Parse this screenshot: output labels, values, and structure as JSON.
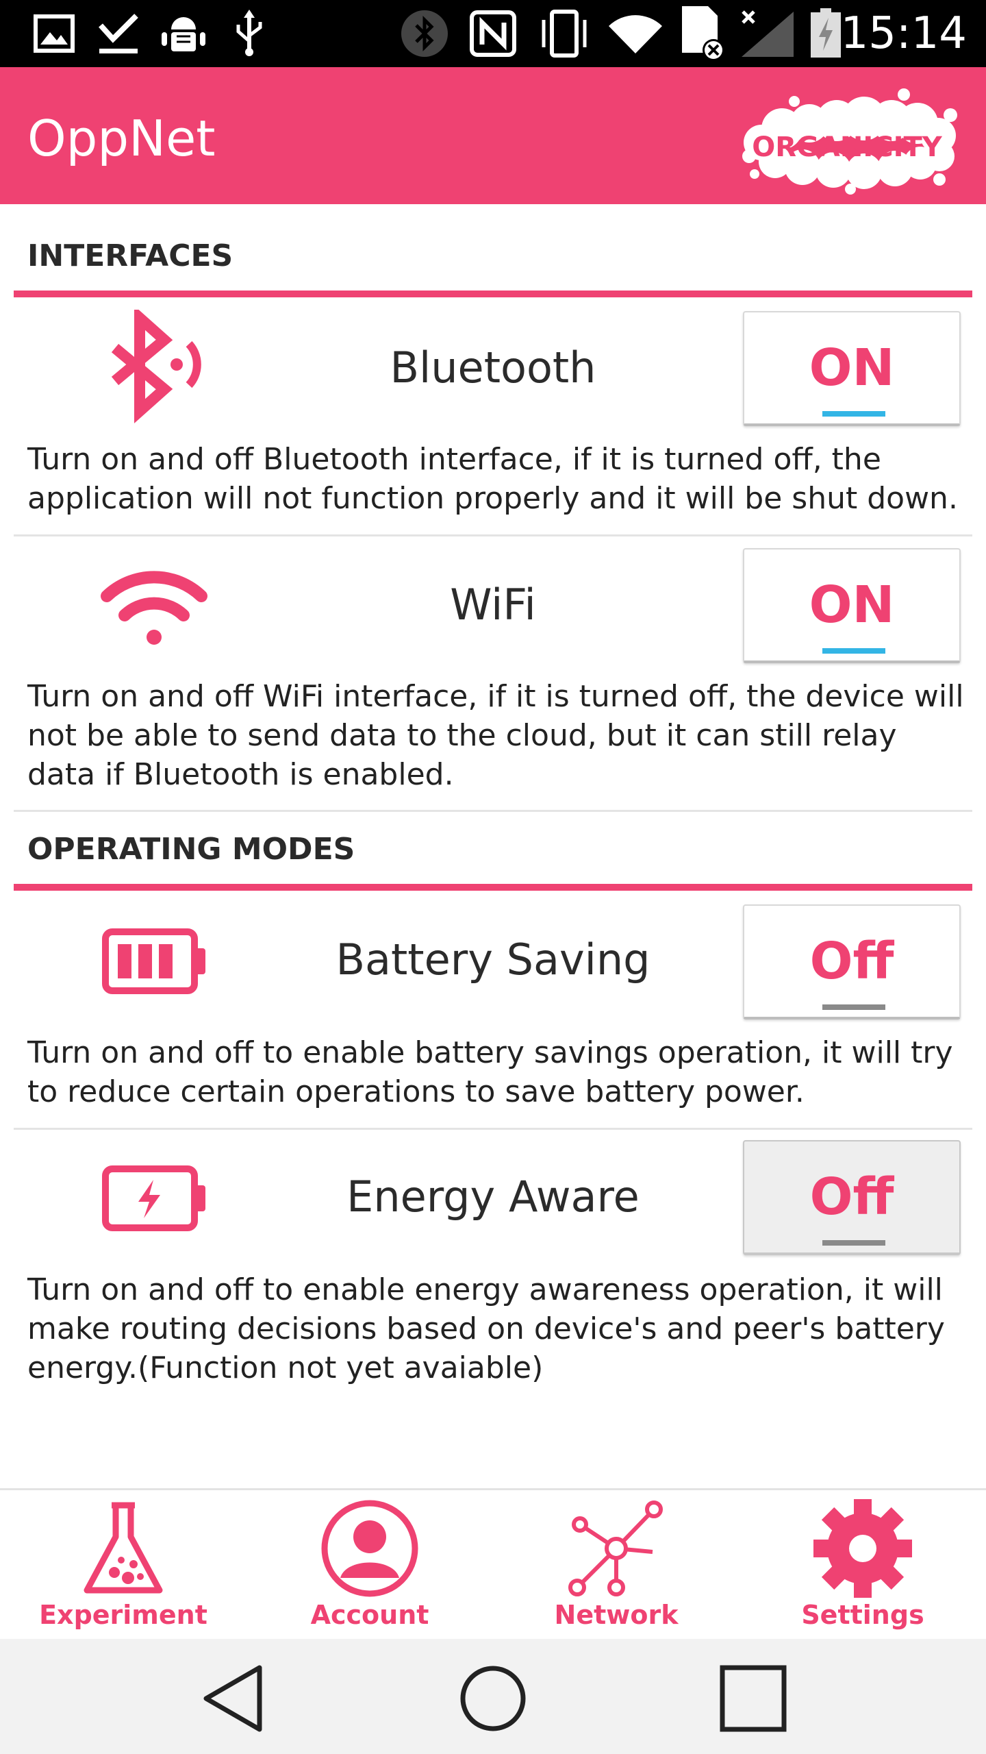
{
  "status_bar": {
    "time": "15:14",
    "icons": [
      "image-icon",
      "download-done-icon",
      "android-debug-icon",
      "usb-icon",
      "bluetooth-icon",
      "nfc-icon",
      "vibrate-icon",
      "wifi-icon",
      "sim-error-icon",
      "cell-signal-icon",
      "battery-charging-icon"
    ]
  },
  "app_bar": {
    "title": "OppNet",
    "logo_text": "ORGANICITY"
  },
  "colors": {
    "accent": "#ef4272",
    "on_indicator": "#33b5e5",
    "off_indicator": "#8a8a8a"
  },
  "sections": {
    "interfaces": {
      "header": "INTERFACES",
      "items": [
        {
          "label": "Bluetooth",
          "state": "ON",
          "icon": "bluetooth-icon",
          "description": "Turn on and off Bluetooth interface, if it is turned off, the application will not function properly and it will be shut down."
        },
        {
          "label": "WiFi",
          "state": "ON",
          "icon": "wifi-icon",
          "description": "Turn on and off WiFi interface, if it is turned off, the device will not be able to send data to the cloud, but it can still relay data if Bluetooth is enabled."
        }
      ]
    },
    "operating_modes": {
      "header": "OPERATING MODES",
      "items": [
        {
          "label": "Battery Saving",
          "state": "Off",
          "icon": "battery-full-icon",
          "description": "Turn on and off to enable battery savings operation, it will try to reduce certain operations to save battery power."
        },
        {
          "label": "Energy Aware",
          "state": "Off",
          "icon": "battery-charging-icon",
          "description": "Turn on and off to enable energy awareness operation, it will make routing decisions based on device's and peer's battery energy.(Function not yet avaiable)"
        }
      ]
    }
  },
  "bottom_nav": [
    {
      "label": "Experiment",
      "icon": "flask-icon"
    },
    {
      "label": "Account",
      "icon": "account-icon"
    },
    {
      "label": "Network",
      "icon": "network-icon"
    },
    {
      "label": "Settings",
      "icon": "gear-icon"
    }
  ],
  "system_nav": {
    "buttons": [
      "back-icon",
      "home-icon",
      "recents-icon"
    ]
  }
}
